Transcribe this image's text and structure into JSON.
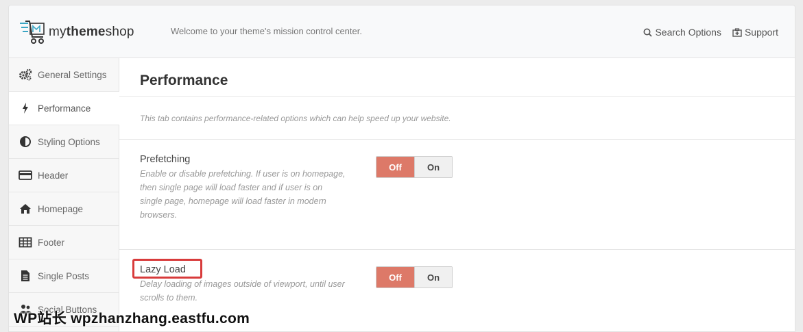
{
  "header": {
    "logo": {
      "prefix": "my",
      "bold": "theme",
      "suffix": "shop"
    },
    "welcome": "Welcome to your theme's mission control center.",
    "search_label": "Search Options",
    "support_label": "Support"
  },
  "sidebar": {
    "items": [
      {
        "label": "General Settings",
        "icon": "gears-icon"
      },
      {
        "label": "Performance",
        "icon": "bolt-icon",
        "active": true
      },
      {
        "label": "Styling Options",
        "icon": "contrast-icon"
      },
      {
        "label": "Header",
        "icon": "card-icon"
      },
      {
        "label": "Homepage",
        "icon": "home-icon"
      },
      {
        "label": "Footer",
        "icon": "table-icon"
      },
      {
        "label": "Single Posts",
        "icon": "document-icon"
      },
      {
        "label": "Social Buttons",
        "icon": "users-icon"
      }
    ]
  },
  "main": {
    "title": "Performance",
    "intro": "This tab contains performance-related options which can help speed up your website.",
    "options": [
      {
        "title": "Prefetching",
        "desc": "Enable or disable prefetching. If user is on homepage, then single page will load faster and if user is on single page, homepage will load faster in modern browsers.",
        "off_label": "Off",
        "on_label": "On",
        "value": "Off"
      },
      {
        "title": "Lazy Load",
        "desc": "Delay loading of images outside of viewport, until user scrolls to them.",
        "off_label": "Off",
        "on_label": "On",
        "value": "Off"
      }
    ]
  },
  "watermark": "WP站长  wpzhanzhang.eastfu.com",
  "colors": {
    "toggle_off": "#dd7968",
    "highlight": "#d83b3b",
    "logo_accent": "#3aa6c4"
  }
}
